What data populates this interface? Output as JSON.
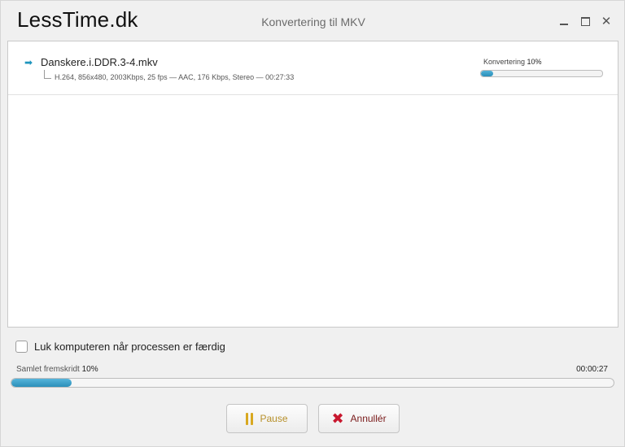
{
  "brand": "LessTime.dk",
  "window": {
    "title": "Konvertering til MKV"
  },
  "file": {
    "name": "Danskere.i.DDR.3-4.mkv",
    "meta": "H.264, 856x480, 2003Kbps, 25 fps — AAC, 176 Kbps, Stereo — 00:27:33",
    "status_label": "Konvertering",
    "progress_text": "10%",
    "progress_fraction": 0.1
  },
  "shutdown": {
    "label": "Luk komputeren når processen er færdig",
    "checked": false
  },
  "total": {
    "label": "Samlet fremskridt",
    "progress_text": "10%",
    "progress_fraction": 0.1,
    "elapsed": "00:00:27"
  },
  "buttons": {
    "pause": "Pause",
    "cancel": "Annullér"
  },
  "colors": {
    "progress": "#2a8fba",
    "pause_icon": "#d8a820",
    "cancel_icon": "#c8182f"
  },
  "icons": {
    "row": "arrow-right-icon",
    "pause": "pause-icon",
    "cancel": "x-icon"
  }
}
